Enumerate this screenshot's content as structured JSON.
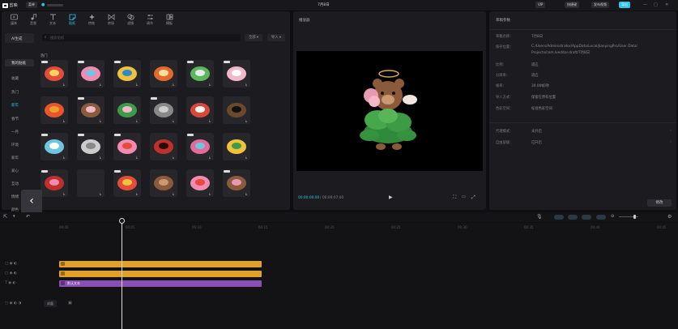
{
  "app": {
    "name": "剪映",
    "menu_label": "菜单",
    "project_title": "7月8日",
    "vip_label": "VIP",
    "shortcut_label": "快捷键",
    "publish_label": "发布视频",
    "export_label": "导出"
  },
  "toolbar": {
    "items": [
      {
        "label": "媒体",
        "icon": "media-icon"
      },
      {
        "label": "音频",
        "icon": "audio-icon"
      },
      {
        "label": "文本",
        "icon": "text-icon"
      },
      {
        "label": "贴纸",
        "icon": "sticker-icon"
      },
      {
        "label": "特效",
        "icon": "effects-icon"
      },
      {
        "label": "转场",
        "icon": "transition-icon"
      },
      {
        "label": "滤镜",
        "icon": "filter-icon"
      },
      {
        "label": "调节",
        "icon": "adjust-icon"
      },
      {
        "label": "模板",
        "icon": "template-icon"
      }
    ],
    "active_index": 3
  },
  "sticker_panel": {
    "search_placeholder": "搜索贴纸",
    "filter_label": "全部",
    "import_label": "导入",
    "sidebar": [
      "AI生成",
      "我的贴纸",
      "收藏",
      "热门",
      "新年",
      "春节",
      "一月",
      "环境",
      "新年",
      "爱心",
      "互动",
      "情绪",
      "颜色"
    ],
    "section_label": "热门",
    "stickers": [
      {
        "name": "sticker-text-red"
      },
      {
        "name": "sticker-text-pink"
      },
      {
        "name": "sticker-pinwheel"
      },
      {
        "name": "sticker-burst"
      },
      {
        "name": "sticker-banner-green"
      },
      {
        "name": "sticker-hearts-wings"
      },
      {
        "name": "sticker-fire"
      },
      {
        "name": "sticker-angel-bear"
      },
      {
        "name": "sticker-lotus"
      },
      {
        "name": "sticker-paper-plane"
      },
      {
        "name": "sticker-red-label"
      },
      {
        "name": "sticker-dog-glasses"
      },
      {
        "name": "sticker-speech-bubble"
      },
      {
        "name": "sticker-plane-white"
      },
      {
        "name": "sticker-pink-text"
      },
      {
        "name": "sticker-heart-outline"
      },
      {
        "name": "sticker-pixel-banner"
      },
      {
        "name": "sticker-sunflower"
      },
      {
        "name": "sticker-red-script"
      },
      {
        "name": "sticker-blank"
      },
      {
        "name": "sticker-rainbow"
      },
      {
        "name": "sticker-bear-face"
      },
      {
        "name": "sticker-small-hearts"
      },
      {
        "name": "sticker-bear-hearts"
      }
    ]
  },
  "player": {
    "title": "播放器",
    "time_current": "00:00:00:00",
    "time_total": "00:00:07:00"
  },
  "properties": {
    "title": "草稿参数",
    "rows": [
      {
        "k": "草稿名称：",
        "v": "7月8日"
      },
      {
        "k": "保存位置：",
        "v": "C:/Users/Administrator/AppData/Local/JianyingPro/User Data/"
      },
      {
        "k": "",
        "v": "Projects/com.lveditor.draft/7月8日"
      },
      {
        "k": "比例：",
        "v": "适应"
      },
      {
        "k": "分辨率：",
        "v": "适应"
      },
      {
        "k": "帧率：",
        "v": "30.00帧/秒"
      },
      {
        "k": "导入方式：",
        "v": "保留在原有位置"
      },
      {
        "k": "色彩空间：",
        "v": "标准色彩空间"
      }
    ],
    "rows2": [
      {
        "k": "代理模式：",
        "v": "未开启"
      },
      {
        "k": "自由层级：",
        "v": "已开启"
      }
    ],
    "modify_label": "修改"
  },
  "timeline": {
    "ticks": [
      "00:00",
      "00:05",
      "00:10",
      "00:15",
      "00:20",
      "00:25",
      "00:30",
      "00:35",
      "00:40",
      "00:45"
    ],
    "cover_label": "封面",
    "tracks": [
      {
        "name": "track-sticker-1",
        "color": "#e0a02a",
        "label": ""
      },
      {
        "name": "track-sticker-2",
        "color": "#e0a02a",
        "label": ""
      },
      {
        "name": "track-text",
        "color": "#8a4fb5",
        "label": "默认文本"
      }
    ]
  },
  "colors": {
    "accent": "#2ec5e8",
    "track_orange": "#e0a02a",
    "track_purple": "#8a4fb5"
  }
}
